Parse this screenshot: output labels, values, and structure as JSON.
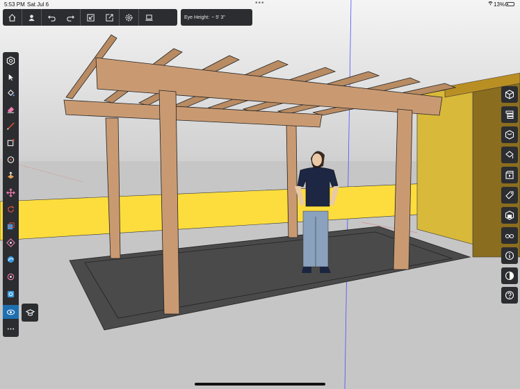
{
  "status_bar": {
    "time": "5:53 PM",
    "date": "Sat Jul 6",
    "battery": "13%"
  },
  "toolbar": {
    "buttons": [
      {
        "name": "home-icon"
      },
      {
        "name": "profile-icon"
      },
      {
        "name": "undo-icon"
      },
      {
        "name": "redo-icon"
      },
      {
        "name": "import-icon"
      },
      {
        "name": "export-icon"
      },
      {
        "name": "settings-icon"
      },
      {
        "name": "laptop-icon"
      }
    ]
  },
  "eye_height": {
    "label": "Eye Height:",
    "value": "~ 5' 3\""
  },
  "left_tools": [
    "model-info-icon",
    "select-icon",
    "paint-bucket-icon",
    "eraser-icon",
    "pencil-line-icon",
    "rectangle-icon",
    "circle-icon",
    "push-pull-icon",
    "move-icon",
    "rotate-icon",
    "scale-icon",
    "offset-icon",
    "orbit-icon",
    "section-plane-icon",
    "tape-measure-icon",
    "walk-icon",
    "look-around-icon",
    "more-icon"
  ],
  "flyout": {
    "icon": "graduation-cap-icon"
  },
  "right_panel": [
    "entity-info-icon",
    "outliner-icon",
    "components-icon",
    "materials-icon",
    "scenes-icon",
    "tags-icon",
    "views-icon",
    "display-icon",
    "info-icon",
    "styles-icon",
    "help-icon"
  ],
  "colors": {
    "toolbar_bg": "#2c2d30",
    "accent_blue": "#1e6fb0",
    "wall_yellow": "#fddd3d",
    "wood": "#c99a72",
    "floor": "#4a4a4a"
  }
}
